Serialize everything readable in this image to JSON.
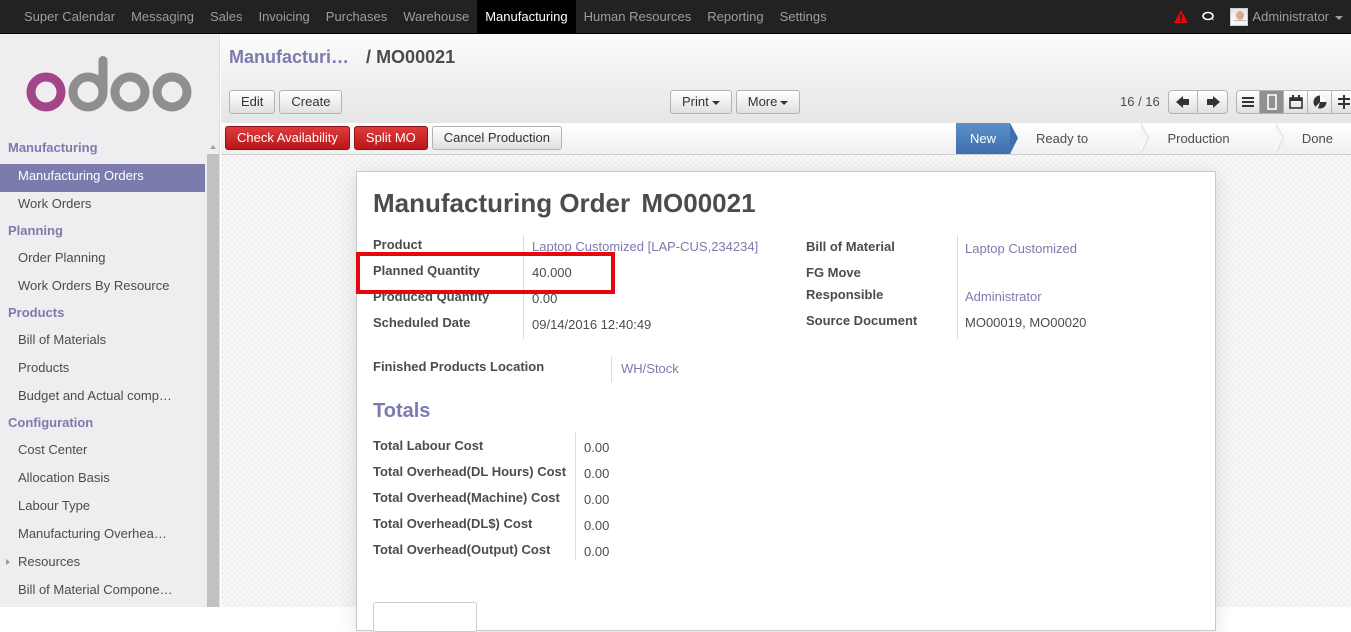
{
  "topbar": {
    "menu": [
      {
        "label": "Super Calendar",
        "active": false
      },
      {
        "label": "Messaging",
        "active": false
      },
      {
        "label": "Sales",
        "active": false
      },
      {
        "label": "Invoicing",
        "active": false
      },
      {
        "label": "Purchases",
        "active": false
      },
      {
        "label": "Warehouse",
        "active": false
      },
      {
        "label": "Manufacturing",
        "active": true
      },
      {
        "label": "Human Resources",
        "active": false
      },
      {
        "label": "Reporting",
        "active": false
      },
      {
        "label": "Settings",
        "active": false
      }
    ],
    "icons": {
      "alert": "warning-triangle-icon",
      "chat": "chat-bubbles-icon"
    },
    "alert_color": "#e6060c",
    "user": "Administrator"
  },
  "sidebar": {
    "logo_text": "odoo",
    "sections": [
      {
        "title": "Manufacturing",
        "items": [
          {
            "label": "Manufacturing Orders",
            "active": true
          },
          {
            "label": "Work Orders"
          }
        ]
      },
      {
        "title": "Planning",
        "items": [
          {
            "label": "Order Planning"
          },
          {
            "label": "Work Orders By Resource"
          }
        ]
      },
      {
        "title": "Products",
        "items": [
          {
            "label": "Bill of Materials"
          },
          {
            "label": "Products"
          },
          {
            "label": "Budget and Actual comp…"
          }
        ]
      },
      {
        "title": "Configuration",
        "items": [
          {
            "label": "Cost Center"
          },
          {
            "label": "Allocation Basis"
          },
          {
            "label": "Labour Type"
          },
          {
            "label": "Manufacturing Overhea…"
          },
          {
            "label": "Resources",
            "expandable": true
          },
          {
            "label": "Bill of Material Compone…"
          }
        ]
      }
    ]
  },
  "control_panel": {
    "breadcrumb": {
      "parent": "Manufacturi…",
      "separator": "/",
      "current": "MO00021"
    },
    "buttons": {
      "edit": "Edit",
      "create": "Create",
      "print": "Print",
      "more": "More"
    },
    "pager": "16 / 16",
    "views": [
      "list-view-icon",
      "form-view-icon",
      "calendar-view-icon",
      "graph-view-icon",
      "gantt-view-icon"
    ],
    "active_view": "form-view-icon"
  },
  "statusbar": {
    "actions": {
      "check_availability": "Check Availability",
      "split_mo": "Split MO",
      "cancel_production": "Cancel Production"
    },
    "stages": [
      {
        "label": "New",
        "active": true
      },
      {
        "label": "Ready to Produce"
      },
      {
        "label": "Production Started"
      },
      {
        "label": "Done"
      }
    ]
  },
  "form": {
    "title": "Manufacturing Order",
    "number": "MO00021",
    "left_fields": {
      "product": {
        "label": "Product",
        "value": "Laptop Customized [LAP-CUS,234234]"
      },
      "planned_qty": {
        "label": "Planned Quantity",
        "value": "40.000"
      },
      "produced_qty": {
        "label": "Produced Quantity",
        "value": "0.00"
      },
      "scheduled_date": {
        "label": "Scheduled Date",
        "value": "09/14/2016 12:40:49"
      }
    },
    "right_fields": {
      "bom": {
        "label": "Bill of Material",
        "value": "Laptop Customized"
      },
      "fg_move": {
        "label": "FG Move",
        "value": ""
      },
      "responsible": {
        "label": "Responsible",
        "value": "Administrator"
      },
      "source_doc": {
        "label": "Source Document",
        "value": "MO00019, MO00020"
      }
    },
    "location": {
      "label": "Finished Products Location",
      "value": "WH/Stock"
    },
    "totals_title": "Totals",
    "totals": [
      {
        "label": "Total Labour Cost",
        "value": "0.00"
      },
      {
        "label": "Total Overhead(DL Hours) Cost",
        "value": "0.00"
      },
      {
        "label": "Total Overhead(Machine) Cost",
        "value": "0.00"
      },
      {
        "label": "Total Overhead(DL$) Cost",
        "value": "0.00"
      },
      {
        "label": "Total Overhead(Output) Cost",
        "value": "0.00"
      }
    ]
  },
  "annotation": {
    "highlighted_field": "Planned Quantity",
    "color": "#e6060c"
  }
}
